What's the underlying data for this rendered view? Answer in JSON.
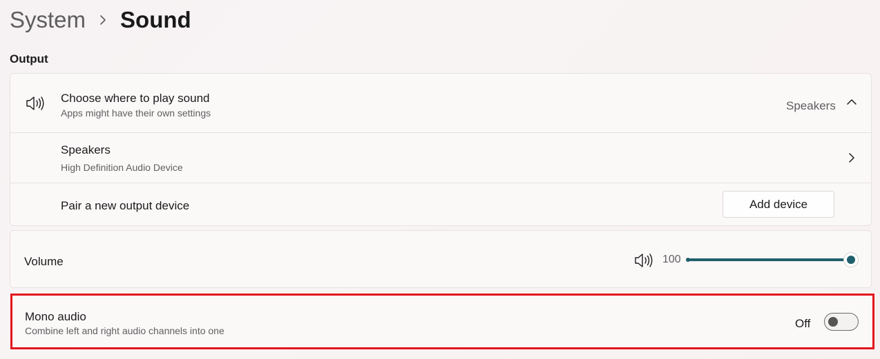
{
  "breadcrumb": {
    "parent": "System",
    "current": "Sound"
  },
  "output": {
    "section_label": "Output",
    "choose": {
      "title": "Choose where to play sound",
      "subtitle": "Apps might have their own settings",
      "selected": "Speakers",
      "icon": "speaker-icon",
      "expanded": true
    },
    "speakers": {
      "title": "Speakers",
      "subtitle": "High Definition Audio Device",
      "icon": "chevron-right-icon"
    },
    "pair": {
      "title": "Pair a new output device",
      "button_label": "Add device"
    }
  },
  "volume": {
    "label": "Volume",
    "value": "100",
    "level": 1.0,
    "icon": "speaker-icon"
  },
  "mono": {
    "title": "Mono audio",
    "subtitle": "Combine left and right audio channels into one",
    "state_label": "Off",
    "on": false
  },
  "colors": {
    "accent": "#1f5f6b",
    "highlight": "#e2151c"
  }
}
